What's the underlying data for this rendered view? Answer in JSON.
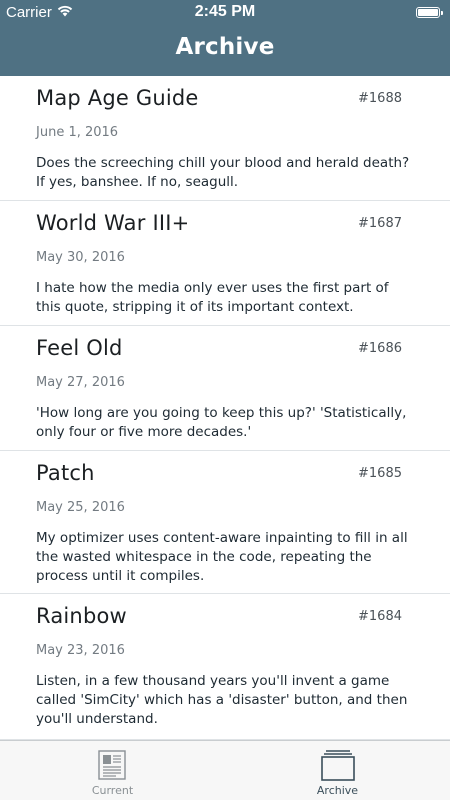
{
  "status_bar": {
    "carrier": "Carrier",
    "time": "2:45 PM"
  },
  "header": {
    "title": "Archive"
  },
  "items": [
    {
      "title": "Map Age Guide",
      "number": "#1688",
      "date": "June 1, 2016",
      "description": "Does the screeching chill your blood and herald death? If yes, banshee. If no, seagull."
    },
    {
      "title": "World War III+",
      "number": "#1687",
      "date": "May 30, 2016",
      "description": "I hate how the media only ever uses the first part of this quote, stripping it of its important context."
    },
    {
      "title": "Feel Old",
      "number": "#1686",
      "date": "May 27, 2016",
      "description": "'How long are you going to keep this up?' 'Statistically, only four or five more decades.'"
    },
    {
      "title": "Patch",
      "number": "#1685",
      "date": "May 25, 2016",
      "description": "My optimizer uses content-aware inpainting to fill in all the wasted whitespace in the code, repeating the process until it compiles."
    },
    {
      "title": "Rainbow",
      "number": "#1684",
      "date": "May 23, 2016",
      "description": "Listen, in a few thousand years you'll invent a game called 'SimCity' which has a 'disaster' button, and then you'll understand."
    }
  ],
  "tabbar": {
    "tabs": [
      {
        "label": "Current",
        "icon": "newspaper-icon",
        "selected": false
      },
      {
        "label": "Archive",
        "icon": "archive-box-icon",
        "selected": true
      }
    ]
  },
  "colors": {
    "header_bg": "#4f7183",
    "tab_selected": "#3a4e5a",
    "tab_unselected": "#8a9094"
  }
}
